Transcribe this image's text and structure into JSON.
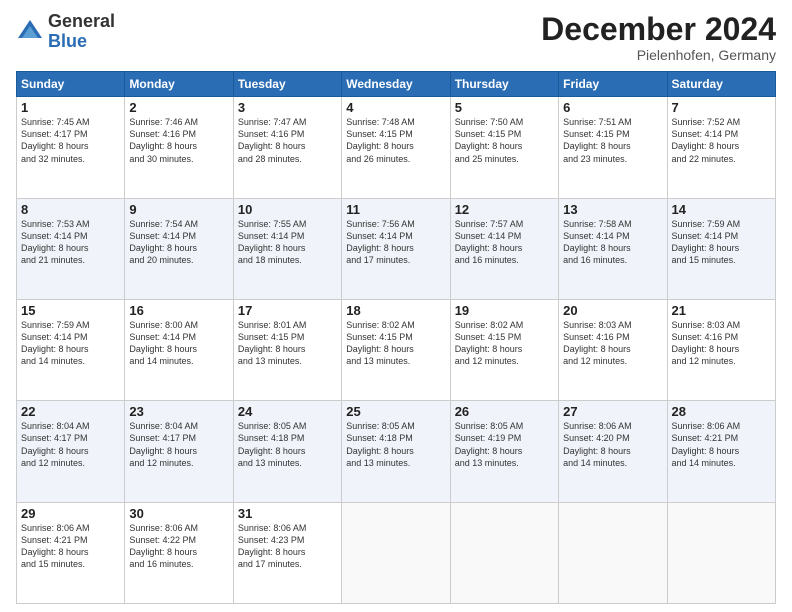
{
  "logo": {
    "general": "General",
    "blue": "Blue"
  },
  "header": {
    "month": "December 2024",
    "location": "Pielenhofen, Germany"
  },
  "weekdays": [
    "Sunday",
    "Monday",
    "Tuesday",
    "Wednesday",
    "Thursday",
    "Friday",
    "Saturday"
  ],
  "weeks": [
    [
      {
        "day": "1",
        "info": "Sunrise: 7:45 AM\nSunset: 4:17 PM\nDaylight: 8 hours\nand 32 minutes."
      },
      {
        "day": "2",
        "info": "Sunrise: 7:46 AM\nSunset: 4:16 PM\nDaylight: 8 hours\nand 30 minutes."
      },
      {
        "day": "3",
        "info": "Sunrise: 7:47 AM\nSunset: 4:16 PM\nDaylight: 8 hours\nand 28 minutes."
      },
      {
        "day": "4",
        "info": "Sunrise: 7:48 AM\nSunset: 4:15 PM\nDaylight: 8 hours\nand 26 minutes."
      },
      {
        "day": "5",
        "info": "Sunrise: 7:50 AM\nSunset: 4:15 PM\nDaylight: 8 hours\nand 25 minutes."
      },
      {
        "day": "6",
        "info": "Sunrise: 7:51 AM\nSunset: 4:15 PM\nDaylight: 8 hours\nand 23 minutes."
      },
      {
        "day": "7",
        "info": "Sunrise: 7:52 AM\nSunset: 4:14 PM\nDaylight: 8 hours\nand 22 minutes."
      }
    ],
    [
      {
        "day": "8",
        "info": "Sunrise: 7:53 AM\nSunset: 4:14 PM\nDaylight: 8 hours\nand 21 minutes."
      },
      {
        "day": "9",
        "info": "Sunrise: 7:54 AM\nSunset: 4:14 PM\nDaylight: 8 hours\nand 20 minutes."
      },
      {
        "day": "10",
        "info": "Sunrise: 7:55 AM\nSunset: 4:14 PM\nDaylight: 8 hours\nand 18 minutes."
      },
      {
        "day": "11",
        "info": "Sunrise: 7:56 AM\nSunset: 4:14 PM\nDaylight: 8 hours\nand 17 minutes."
      },
      {
        "day": "12",
        "info": "Sunrise: 7:57 AM\nSunset: 4:14 PM\nDaylight: 8 hours\nand 16 minutes."
      },
      {
        "day": "13",
        "info": "Sunrise: 7:58 AM\nSunset: 4:14 PM\nDaylight: 8 hours\nand 16 minutes."
      },
      {
        "day": "14",
        "info": "Sunrise: 7:59 AM\nSunset: 4:14 PM\nDaylight: 8 hours\nand 15 minutes."
      }
    ],
    [
      {
        "day": "15",
        "info": "Sunrise: 7:59 AM\nSunset: 4:14 PM\nDaylight: 8 hours\nand 14 minutes."
      },
      {
        "day": "16",
        "info": "Sunrise: 8:00 AM\nSunset: 4:14 PM\nDaylight: 8 hours\nand 14 minutes."
      },
      {
        "day": "17",
        "info": "Sunrise: 8:01 AM\nSunset: 4:15 PM\nDaylight: 8 hours\nand 13 minutes."
      },
      {
        "day": "18",
        "info": "Sunrise: 8:02 AM\nSunset: 4:15 PM\nDaylight: 8 hours\nand 13 minutes."
      },
      {
        "day": "19",
        "info": "Sunrise: 8:02 AM\nSunset: 4:15 PM\nDaylight: 8 hours\nand 12 minutes."
      },
      {
        "day": "20",
        "info": "Sunrise: 8:03 AM\nSunset: 4:16 PM\nDaylight: 8 hours\nand 12 minutes."
      },
      {
        "day": "21",
        "info": "Sunrise: 8:03 AM\nSunset: 4:16 PM\nDaylight: 8 hours\nand 12 minutes."
      }
    ],
    [
      {
        "day": "22",
        "info": "Sunrise: 8:04 AM\nSunset: 4:17 PM\nDaylight: 8 hours\nand 12 minutes."
      },
      {
        "day": "23",
        "info": "Sunrise: 8:04 AM\nSunset: 4:17 PM\nDaylight: 8 hours\nand 12 minutes."
      },
      {
        "day": "24",
        "info": "Sunrise: 8:05 AM\nSunset: 4:18 PM\nDaylight: 8 hours\nand 13 minutes."
      },
      {
        "day": "25",
        "info": "Sunrise: 8:05 AM\nSunset: 4:18 PM\nDaylight: 8 hours\nand 13 minutes."
      },
      {
        "day": "26",
        "info": "Sunrise: 8:05 AM\nSunset: 4:19 PM\nDaylight: 8 hours\nand 13 minutes."
      },
      {
        "day": "27",
        "info": "Sunrise: 8:06 AM\nSunset: 4:20 PM\nDaylight: 8 hours\nand 14 minutes."
      },
      {
        "day": "28",
        "info": "Sunrise: 8:06 AM\nSunset: 4:21 PM\nDaylight: 8 hours\nand 14 minutes."
      }
    ],
    [
      {
        "day": "29",
        "info": "Sunrise: 8:06 AM\nSunset: 4:21 PM\nDaylight: 8 hours\nand 15 minutes."
      },
      {
        "day": "30",
        "info": "Sunrise: 8:06 AM\nSunset: 4:22 PM\nDaylight: 8 hours\nand 16 minutes."
      },
      {
        "day": "31",
        "info": "Sunrise: 8:06 AM\nSunset: 4:23 PM\nDaylight: 8 hours\nand 17 minutes."
      },
      null,
      null,
      null,
      null
    ]
  ]
}
